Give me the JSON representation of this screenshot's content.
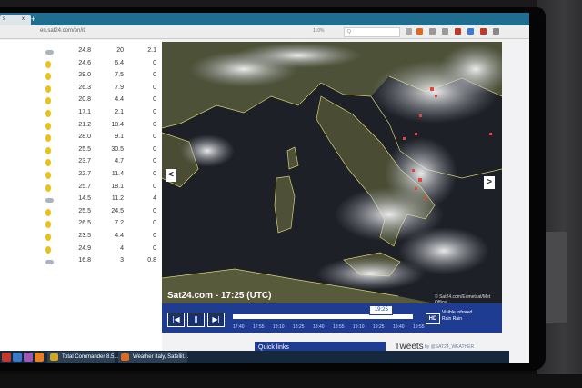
{
  "browser": {
    "tab_label": "s",
    "tab_close": "x",
    "new_tab": "+",
    "url": "en.sat24.com/en/it",
    "zoom": "110%",
    "search_label": "Q"
  },
  "weather_table": [
    {
      "icon": "cloud-sun-icon",
      "c1": "24.8",
      "c2": "20",
      "c3": "2.1"
    },
    {
      "icon": "sun-icon",
      "c1": "24.6",
      "c2": "6.4",
      "c3": "0"
    },
    {
      "icon": "sun-icon",
      "c1": "29.0",
      "c2": "7.5",
      "c3": "0"
    },
    {
      "icon": "sun-icon",
      "c1": "26.3",
      "c2": "7.9",
      "c3": "0"
    },
    {
      "icon": "sun-icon",
      "c1": "20.8",
      "c2": "4.4",
      "c3": "0"
    },
    {
      "icon": "sun-icon",
      "c1": "17.1",
      "c2": "2.1",
      "c3": "0"
    },
    {
      "icon": "sun-icon",
      "c1": "21.2",
      "c2": "18.4",
      "c3": "0"
    },
    {
      "icon": "sun-icon",
      "c1": "28.0",
      "c2": "9.1",
      "c3": "0"
    },
    {
      "icon": "sun-icon",
      "c1": "25.5",
      "c2": "30.5",
      "c3": "0"
    },
    {
      "icon": "sun-icon",
      "c1": "23.7",
      "c2": "4.7",
      "c3": "0"
    },
    {
      "icon": "sun-icon",
      "c1": "22.7",
      "c2": "11.4",
      "c3": "0"
    },
    {
      "icon": "sun-icon",
      "c1": "25.7",
      "c2": "18.1",
      "c3": "0"
    },
    {
      "icon": "cloud-icon",
      "c1": "14.5",
      "c2": "11.2",
      "c3": "4"
    },
    {
      "icon": "sun-icon",
      "c1": "25.5",
      "c2": "24.5",
      "c3": "0"
    },
    {
      "icon": "sun-icon",
      "c1": "26.5",
      "c2": "7.2",
      "c3": "0"
    },
    {
      "icon": "sun-icon",
      "c1": "23.5",
      "c2": "4.4",
      "c3": "0"
    },
    {
      "icon": "sun-icon",
      "c1": "24.9",
      "c2": "4",
      "c3": "0"
    },
    {
      "icon": "cloud-icon",
      "c1": "16.8",
      "c2": "3",
      "c3": "0.8"
    }
  ],
  "map": {
    "timestamp": "Sat24.com - 17:25 (UTC)",
    "credit": "© Sat24.com/Eumetsat/Met Office",
    "prev_arrow": "<",
    "next_arrow": ">"
  },
  "timeline": {
    "btn_prev": "|◀",
    "btn_pause": "||",
    "btn_next": "▶|",
    "current_time": "19:25",
    "current_fraction": 0.82,
    "times": [
      "17:40",
      "17:55",
      "18:10",
      "18:25",
      "18:40",
      "18:55",
      "19:10",
      "19:25",
      "19:40",
      "19:55"
    ],
    "hd_label": "HD",
    "options": [
      "Visible",
      "Infrared",
      "Rain",
      "Rain"
    ]
  },
  "quick_links": "Quick links",
  "tweets": {
    "label": "Tweets",
    "by": "by @SAT24_WEATHER"
  },
  "taskbar": {
    "items": [
      "Total Commander 8.5...",
      "Weather Italy, Satellit..."
    ]
  }
}
